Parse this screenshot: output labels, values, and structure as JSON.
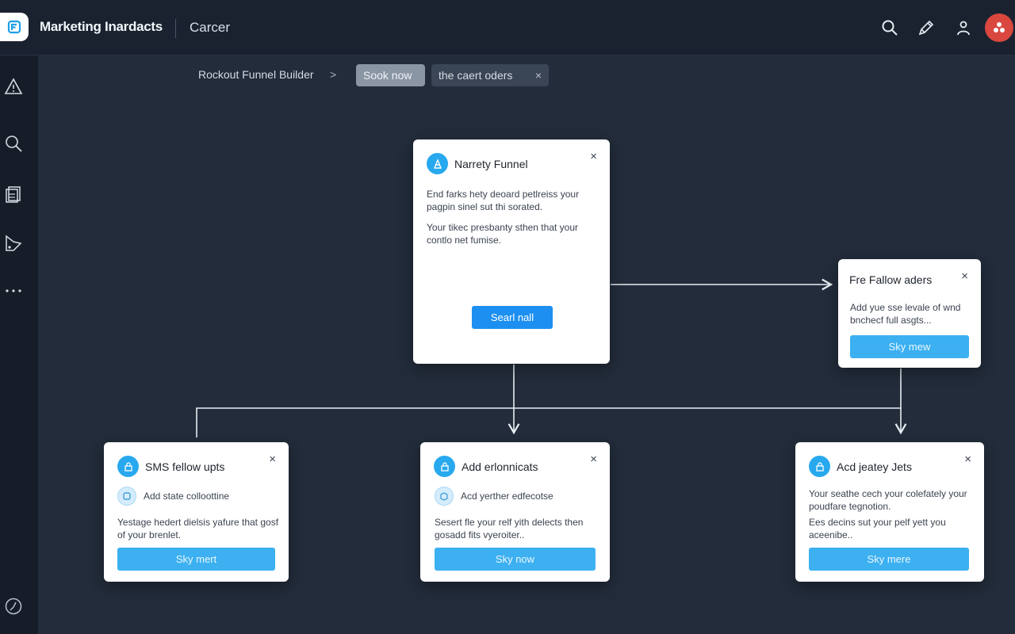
{
  "header": {
    "app_title": "Marketing Inardacts",
    "app_subtitle": "Carcer"
  },
  "breadcrumb": {
    "text": "Rockout Funnel Builder",
    "chevron": ">",
    "pill_primary": "Sook now",
    "pill_secondary": "the caert oders",
    "pill_close": "×"
  },
  "cards": {
    "main": {
      "title": "Narrety Funnel",
      "text1": "End farks hety deoard petlreiss your pagpin sinel sut thi sorated.",
      "text2": "Your tikec presbanty sthen that your contlo net fumise.",
      "button": "Searl nall",
      "close": "×"
    },
    "right": {
      "title": "Fre Fallow aders",
      "text": "Add yue sse levale of wnd bnchecf full asgts...",
      "button": "Sky mew",
      "close": "×"
    },
    "sms": {
      "title": "SMS fellow upts",
      "sub": "Add state colloottine",
      "text": "Yestage hedert dielsis yafure that gosf of your brenlet.",
      "button": "Sky mert",
      "close": "×"
    },
    "enhancements": {
      "title": "Add erlonnicats",
      "sub": "Acd yerther edfecotse",
      "text": "Sesert fle your relf yith delects then gosadd fits vyeroiter..",
      "button": "Sky now",
      "close": "×"
    },
    "jets": {
      "title": "Acd jeatey Jets",
      "text1": "Your seathe cech your colefately your poudfare tegnotion.",
      "text2": "Ees decins sut your pelf yett you aceenibe..",
      "button": "Sky mere",
      "close": "×"
    }
  },
  "colors": {
    "accent": "#28a8ee",
    "primary_button": "#1d8ff0",
    "avatar": "#d9473f",
    "background": "#222c3a"
  }
}
